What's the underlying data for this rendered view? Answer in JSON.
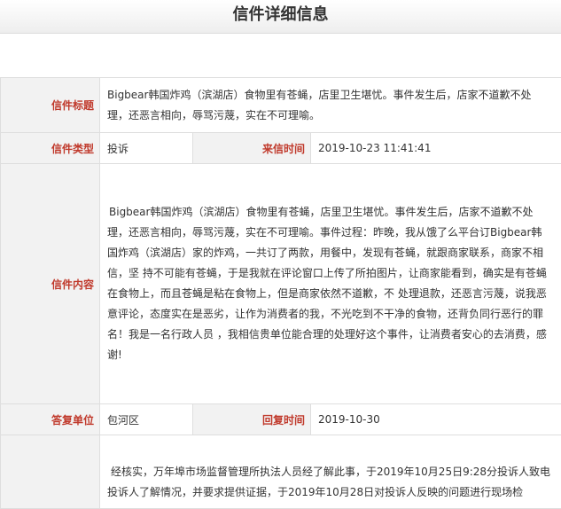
{
  "page": {
    "title": "信件详细信息"
  },
  "letter": {
    "subject_label": "信件标题",
    "subject": "Bigbear韩国炸鸡（滨湖店）食物里有苍蝇，店里卫生堪忧。事件发生后，店家不道歉不处理，还恶言相向，辱骂污蔑，实在不可理喻。",
    "type_label": "信件类型",
    "type": "投诉",
    "received_label": "来信时间",
    "received": "2019-10-23 11:41:41",
    "content_label": "信件内容",
    "content": "Bigbear韩国炸鸡（滨湖店）食物里有苍蝇，店里卫生堪忧。事件发生后，店家不道歉不处理，还恶言相向，辱骂污蔑，实在不可理喻。事件过程：昨晚，我从饿了么平台订Bigbear韩国炸鸡（滨湖店）家的炸鸡，一共订了两款，用餐中，发现有苍蝇，就跟商家联系，商家不相信，坚 持不可能有苍蝇，于是我就在评论窗口上传了所拍图片，让商家能看到，确实是有苍蝇在食物上，而且苍蝇是粘在食物上，但是商家依然不道歉，不 处理退款，还恶言污蔑，说我恶意评论，态度实在是恶劣，让作为消费者的我，不光吃到不干净的食物，还背负同行恶行的罪名！我是一名行政人员 ，我相信贵单位能合理的处理好这个事件，让消费者安心的去消费，感谢!",
    "reply_unit_label": "答复单位",
    "reply_unit": "包河区",
    "reply_time_label": "回复时间",
    "reply_time": "2019-10-30",
    "reply_content": "经核实，万年埠市场监督管理所执法人员经了解此事，于2019年10月25日9:28分投诉人致电投诉人了解情况，并要求提供证据，于2019年10月28日对投诉人反映的问题进行现场检"
  }
}
